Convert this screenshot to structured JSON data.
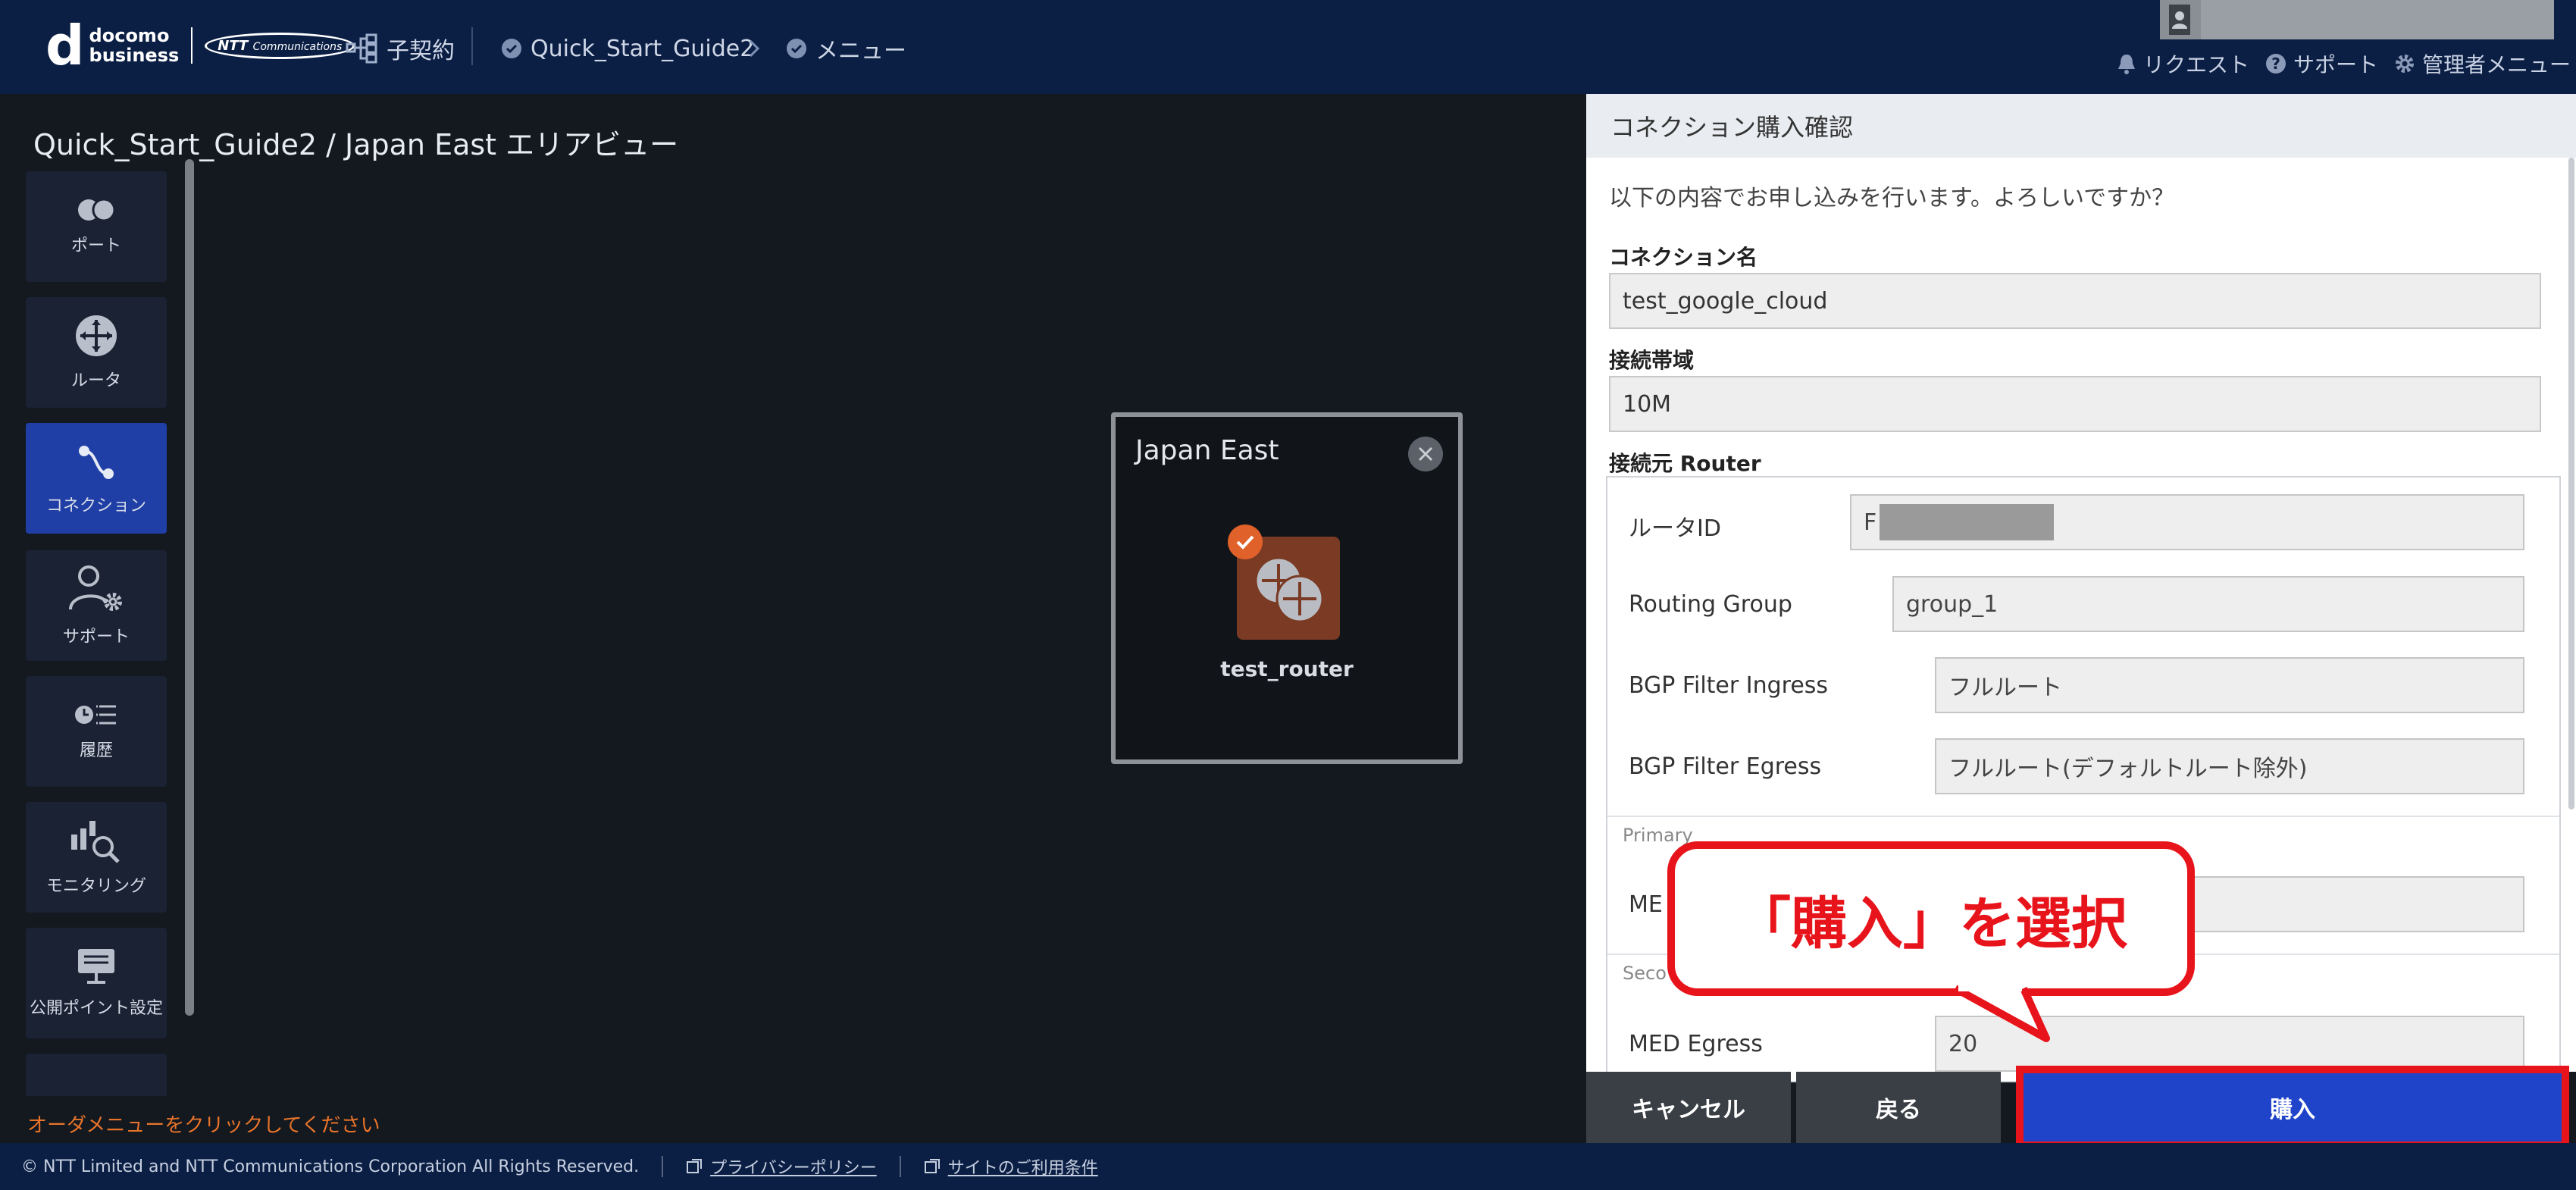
{
  "header": {
    "brand": {
      "d": "d",
      "line1": "docomo",
      "line2": "business",
      "ntt": "NTT",
      "ntt_sub": "Communications"
    },
    "breadcrumb": {
      "contract": "子契約",
      "project": "Quick_Start_Guide2",
      "menu": "メニュー"
    },
    "links": {
      "request": "リクエスト",
      "support": "サポート",
      "admin": "管理者メニュー"
    }
  },
  "page": {
    "title": "Quick_Start_Guide2 / Japan East エリアビュー",
    "order_hint": "オーダメニューをクリックしてください"
  },
  "sidebar": {
    "items": [
      {
        "label": "ポート",
        "icon": "port-icon"
      },
      {
        "label": "ルータ",
        "icon": "router-icon"
      },
      {
        "label": "コネクション",
        "icon": "connection-icon",
        "active": true
      },
      {
        "label": "サポート",
        "icon": "support-icon"
      },
      {
        "label": "履歴",
        "icon": "history-icon"
      },
      {
        "label": "モニタリング",
        "icon": "monitoring-icon"
      },
      {
        "label": "公開ポイント設定",
        "icon": "public-point-icon"
      }
    ]
  },
  "region": {
    "title": "Japan East",
    "router_name": "test_router"
  },
  "panel": {
    "title": "コネクション購入確認",
    "subtitle": "以下の内容でお申し込みを行います。よろしいですか？",
    "connection_name_label": "コネクション名",
    "connection_name": "test_google_cloud",
    "bandwidth_label": "接続帯域",
    "bandwidth": "10M",
    "source_router_label": "接続元 Router",
    "router": {
      "router_id_label": "ルータID",
      "router_id_prefix": "F",
      "routing_group_label": "Routing Group",
      "routing_group": "group_1",
      "bgp_ingress_label": "BGP Filter Ingress",
      "bgp_ingress": "フルルート",
      "bgp_egress_label": "BGP Filter Egress",
      "bgp_egress": "フルルート(デフォルトルート除外)",
      "primary_label": "Primary",
      "primary_med_label": "ME",
      "secondary_label": "Seco",
      "secondary_med_label": "MED Egress",
      "secondary_med": "20"
    }
  },
  "callout": {
    "text": "「購入」を選択"
  },
  "buttons": {
    "cancel": "キャンセル",
    "back": "戻る",
    "buy": "購入"
  },
  "footer": {
    "copyright": "© NTT Limited and NTT Communications Corporation All Rights Reserved.",
    "privacy": "プライバシーポリシー",
    "terms": "サイトのご利用条件"
  },
  "colors": {
    "header_bg": "#0b1f45",
    "accent_blue": "#1f44c9",
    "highlight_red": "#e8141b",
    "router_orange": "#e0612a"
  }
}
